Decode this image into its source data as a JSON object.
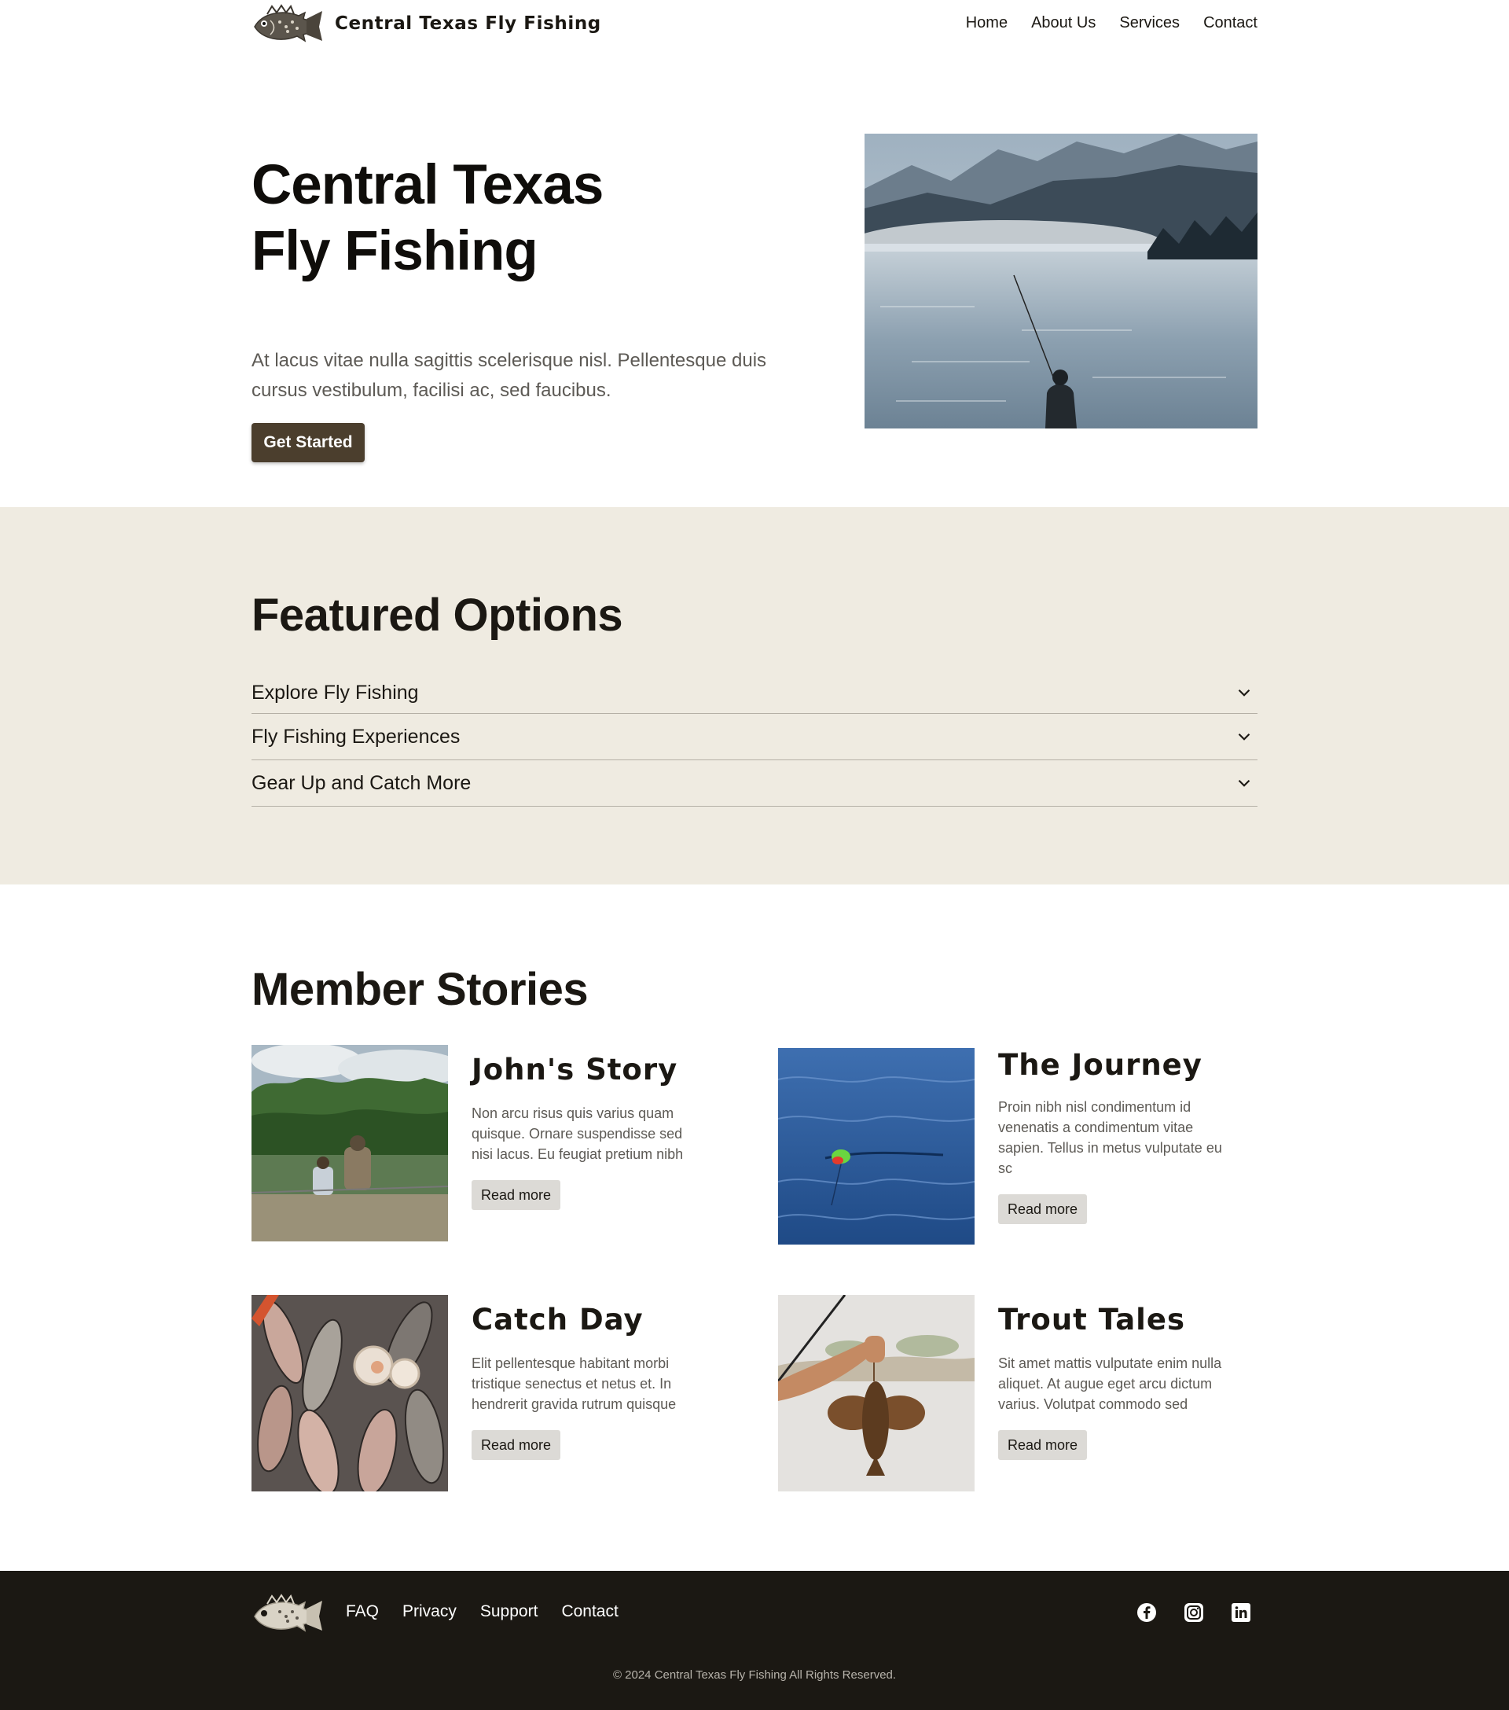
{
  "header": {
    "brand_name": "Central Texas Fly Fishing",
    "logo_icon": "fish-logo-icon",
    "nav": [
      {
        "label": "Home"
      },
      {
        "label": "About Us"
      },
      {
        "label": "Services"
      },
      {
        "label": "Contact"
      }
    ]
  },
  "hero": {
    "title_line1": "Central Texas",
    "title_line2": "Fly Fishing",
    "subtitle": "At lacus vitae nulla sagittis scelerisque nisl. Pellentesque duis cursus vestibulum, facilisi ac, sed faucibus.",
    "cta_label": "Get Started",
    "image": "fisherman-misty-lake-photo"
  },
  "featured": {
    "title": "Featured Options",
    "items": [
      {
        "label": "Explore Fly Fishing"
      },
      {
        "label": "Fly Fishing Experiences"
      },
      {
        "label": "Gear Up and Catch More"
      }
    ]
  },
  "stories": {
    "title": "Member Stories",
    "cards": [
      {
        "title": "John's Story",
        "text": "Non arcu risus quis varius quam quisque. Ornare suspendisse sed nisi lacus. Eu feugiat pretium nibh",
        "button": "Read more",
        "image": "lakeside-anglers-photo"
      },
      {
        "title": "The Journey",
        "text": "Proin nibh nisl condimentum id venenatis a condimentum vitae sapien. Tellus in metus vulputate eu sc",
        "button": "Read more",
        "image": "fishing-float-water-photo"
      },
      {
        "title": "Catch Day",
        "text": "Elit pellentesque habitant morbi tristique senectus et netus et. In hendrerit gravida rutrum quisque",
        "button": "Read more",
        "image": "fish-market-photo"
      },
      {
        "title": "Trout Tales",
        "text": "Sit amet mattis vulputate enim nulla aliquet. At augue eget arcu dictum varius. Volutpat commodo sed",
        "button": "Read more",
        "image": "hand-holding-fish-photo"
      }
    ]
  },
  "footer": {
    "links": [
      {
        "label": "FAQ"
      },
      {
        "label": "Privacy"
      },
      {
        "label": "Support"
      },
      {
        "label": "Contact"
      }
    ],
    "social_icons": [
      "facebook-icon",
      "instagram-icon",
      "linkedin-icon"
    ],
    "copyright": "© 2024 Central Texas Fly Fishing All Rights Reserved."
  },
  "colors": {
    "primary_button": "#4b3e2d",
    "featured_bg": "#efebe1",
    "footer_bg": "#1b1813",
    "read_more_bg": "#dcdad6"
  }
}
